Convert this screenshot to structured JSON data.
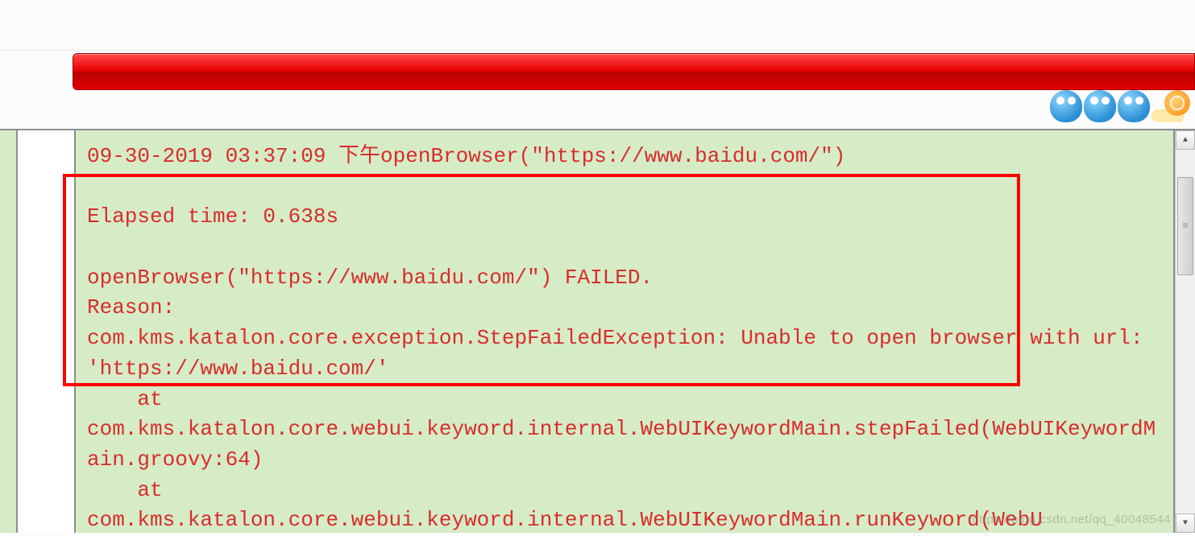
{
  "log": {
    "line_timestamp": "09-30-2019 03:37:09 下午openBrowser(\"https://www.baidu.com/\")",
    "blank1": "",
    "elapsed": "Elapsed time: 0.638s",
    "blank2": "",
    "failed": "openBrowser(\"https://www.baidu.com/\") FAILED.",
    "reason_label": "Reason:",
    "exception": "com.kms.katalon.core.exception.StepFailedException: Unable to open browser with url: 'https://www.baidu.com/'",
    "at1": "    at",
    "trace1": "com.kms.katalon.core.webui.keyword.internal.WebUIKeywordMain.stepFailed(WebUIKeywordMain.groovy:64)",
    "at2": "    at",
    "trace2": "com.kms.katalon.core.webui.keyword.internal.WebUIKeywordMain.runKeyword(WebU"
  },
  "watermark": "https://blog.csdn.net/qq_40048544",
  "scrollbar": {
    "up_glyph": "▲",
    "down_glyph": "▼"
  }
}
